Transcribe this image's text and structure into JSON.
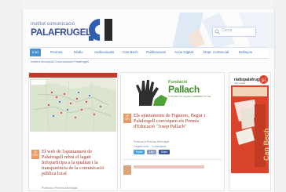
{
  "header": {
    "logo_line1": "institut comunicació",
    "logo_line2": "PALAFRUGELL",
    "search_placeholder": "Cerca",
    "accent": "#4a8fd0"
  },
  "nav": {
    "items": [
      {
        "label": "Inici",
        "active": true
      },
      {
        "label": "Premsa",
        "active": false
      },
      {
        "label": "Ràdio",
        "active": false
      },
      {
        "label": "Audiovisuals",
        "active": false
      },
      {
        "label": "Can Bech",
        "active": false
      },
      {
        "label": "Publicacions",
        "active": false
      },
      {
        "label": "Arxiu Digital",
        "active": false
      },
      {
        "label": "Dept. Comercial",
        "active": false
      },
      {
        "label": "Enllaços",
        "active": false
      }
    ]
  },
  "breadcrumb": "Institut Municipal Comunicació Palafrugell",
  "feature": {
    "date_day": "20",
    "date_month": "DES",
    "headline": "El web de l'ajuntament de Palafrugell rebrà el lagatt Infoparticipa a la qualitat i la transparència de la comunicació pública local",
    "meta": "Publicat a Premsa Municipal"
  },
  "middle": {
    "pallach_small": "Fundació",
    "pallach_big": "Pallach",
    "pallach_tag": "TOTS PER TOT, ALCOLLA ARRIBAR TOT CAL",
    "date_day": "19",
    "date_month": "DES",
    "headline": "Els ajuntaments de Figueres, Begur i Palafrugell convoquen els Premis d'Educació \"Josep Pallach\"",
    "meta": "Publicat a Premsa Municipal",
    "meta2": "Llegeix més... Comentaris",
    "social": {
      "tweet": "Tweet",
      "like": "Like",
      "share": "Share"
    }
  },
  "right": {
    "diari_title": "ràdiopalafrugell",
    "diari_sub": "diari digital",
    "vertical_title": "Can Bech"
  }
}
